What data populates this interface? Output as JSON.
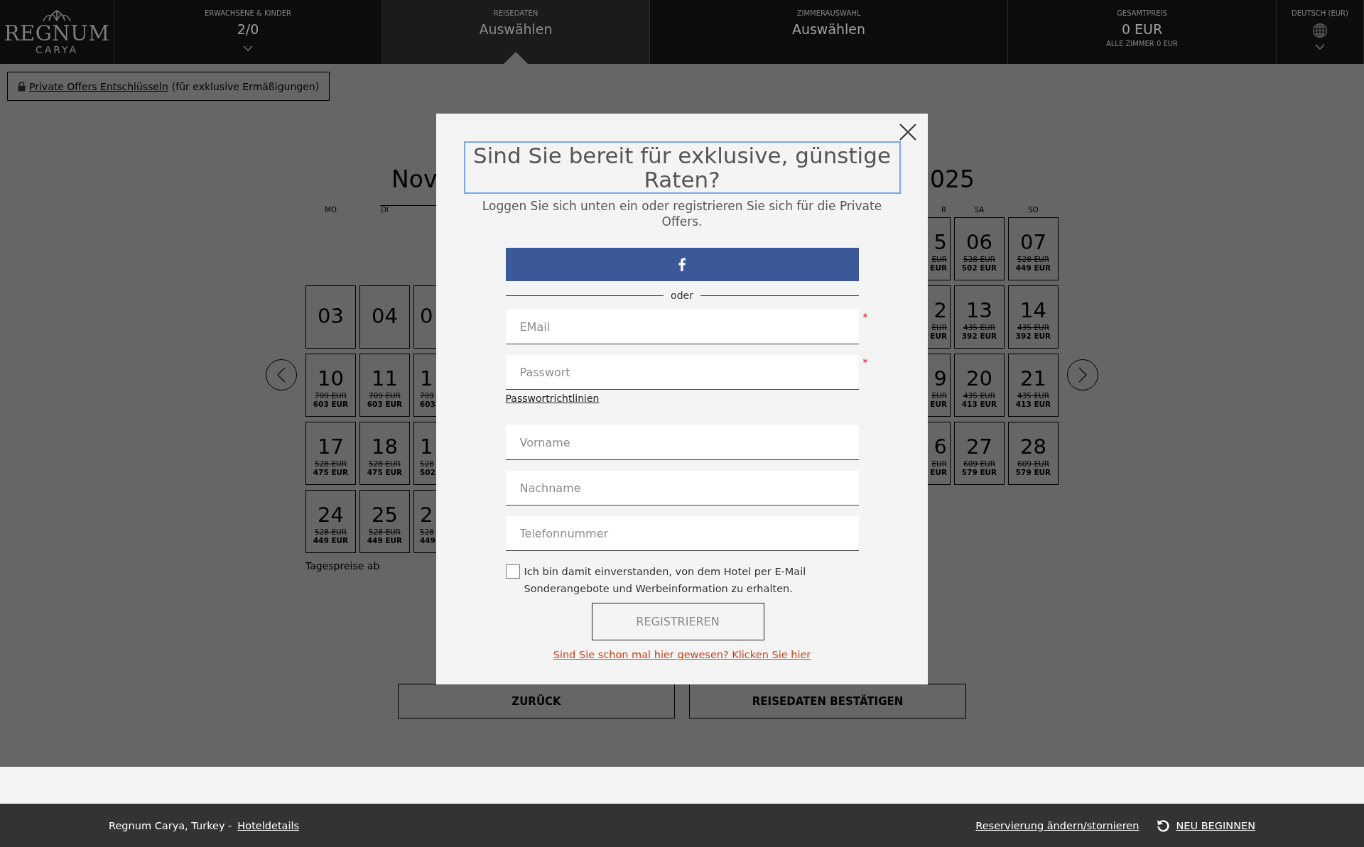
{
  "header": {
    "logo": {
      "name": "REGNUM",
      "subtitle": "CARYA"
    },
    "sections": [
      {
        "kind": "guests",
        "label": "ERWACHSENE & KINDER",
        "value": "2/0",
        "selected": false
      },
      {
        "kind": "dates",
        "label": "REISEDATEN",
        "value": "Auswählen",
        "selected": true
      },
      {
        "kind": "rooms",
        "label": "ZIMMERAUSWAHL",
        "value": "Auswählen",
        "selected": false
      },
      {
        "kind": "total",
        "label": "GESAMTPREIS",
        "value": "0 EUR",
        "note": "ALLE ZIMMER 0 EUR",
        "selected": false
      },
      {
        "kind": "language",
        "label": "DEUTSCH (EUR)",
        "selected": false
      }
    ]
  },
  "private_offers": {
    "link": "Private Offers Entschlüsseln",
    "text": "(für exklusive Ermäßigungen)"
  },
  "calendar": {
    "months": [
      {
        "title": "Nov",
        "weekdays": [
          "MO",
          "DI"
        ],
        "weeks": [
          [
            {
              "kind": "blank"
            },
            {
              "kind": "blank"
            },
            {
              "kind": "blank"
            }
          ],
          [
            {
              "kind": "day",
              "day": "03"
            },
            {
              "kind": "day",
              "day": "04"
            },
            {
              "kind": "cut",
              "day": "0"
            }
          ],
          [
            {
              "kind": "day",
              "day": "10",
              "old_price": "709 EUR",
              "price": "603 EUR"
            },
            {
              "kind": "day",
              "day": "11",
              "old_price": "709 EUR",
              "price": "603 EUR"
            },
            {
              "kind": "cut",
              "day": "1",
              "old_price": "709",
              "price": "603"
            }
          ],
          [
            {
              "kind": "day",
              "day": "17",
              "old_price": "528 EUR",
              "price": "475 EUR"
            },
            {
              "kind": "day",
              "day": "18",
              "old_price": "528 EUR",
              "price": "475 EUR"
            },
            {
              "kind": "cut",
              "day": "1",
              "old_price": "528",
              "price": "502"
            }
          ],
          [
            {
              "kind": "day",
              "day": "24",
              "old_price": "528 EUR",
              "price": "449 EUR"
            },
            {
              "kind": "day",
              "day": "25",
              "old_price": "528 EUR",
              "price": "449 EUR"
            },
            {
              "kind": "cut",
              "day": "2",
              "old_price": "528",
              "price": "449"
            }
          ]
        ]
      },
      {
        "title": "025",
        "weekdays": [
          "R",
          "SA",
          "SO"
        ],
        "weeks": [
          [
            {
              "kind": "cut",
              "day": "5",
              "old_price": "EUR",
              "price": "EUR"
            },
            {
              "kind": "day",
              "day": "06",
              "old_price": "528 EUR",
              "price": "502 EUR"
            },
            {
              "kind": "day",
              "day": "07",
              "old_price": "528 EUR",
              "price": "449 EUR"
            }
          ],
          [
            {
              "kind": "cut",
              "day": "2",
              "old_price": "EUR",
              "price": "EUR"
            },
            {
              "kind": "day",
              "day": "13",
              "old_price": "435 EUR",
              "price": "392 EUR"
            },
            {
              "kind": "day",
              "day": "14",
              "old_price": "435 EUR",
              "price": "392 EUR"
            }
          ],
          [
            {
              "kind": "cut",
              "day": "9",
              "old_price": "EUR",
              "price": "EUR"
            },
            {
              "kind": "day",
              "day": "20",
              "old_price": "435 EUR",
              "price": "413 EUR"
            },
            {
              "kind": "day",
              "day": "21",
              "old_price": "435 EUR",
              "price": "413 EUR"
            }
          ],
          [
            {
              "kind": "cut",
              "day": "6",
              "old_price": "EUR",
              "price": "EUR"
            },
            {
              "kind": "day",
              "day": "27",
              "old_price": "609 EUR",
              "price": "579 EUR"
            },
            {
              "kind": "day",
              "day": "28",
              "old_price": "609 EUR",
              "price": "579 EUR"
            }
          ]
        ]
      }
    ],
    "note": "Tagespreise ab"
  },
  "buttons": [
    "ZURÜCK",
    "REISEDATEN BESTÄTIGEN"
  ],
  "modal": {
    "title": "Sind Sie bereit für exklusive, günstige Raten?",
    "subtitle": "Loggen Sie sich unten ein oder registrieren Sie sich für die Private Offers.",
    "divider": "oder",
    "required_mark": "*",
    "fields": [
      {
        "placeholder": "EMail",
        "required": true
      },
      {
        "placeholder": "Passwort",
        "required": true,
        "link": "Passwortrichtlinien"
      },
      {
        "placeholder": "Vorname",
        "required": false
      },
      {
        "placeholder": "Nachname",
        "required": false
      },
      {
        "placeholder": "Telefonnummer",
        "required": false
      }
    ],
    "consent": {
      "checked": false,
      "text": "Ich bin damit einverstanden, von dem Hotel per E-Mail Sonderangebote und Werbeinformation zu erhalten."
    },
    "register": {
      "label": "REGISTRIEREN",
      "disabled": true
    },
    "login_link": "Sind Sie schon mal hier gewesen? Klicken Sie hier"
  },
  "footer": {
    "hotel": "Regnum Carya, Turkey -",
    "details_link": "Hoteldetails",
    "manage_link": "Reservierung ändern/stornieren",
    "restart": "NEU BEGINNEN"
  }
}
